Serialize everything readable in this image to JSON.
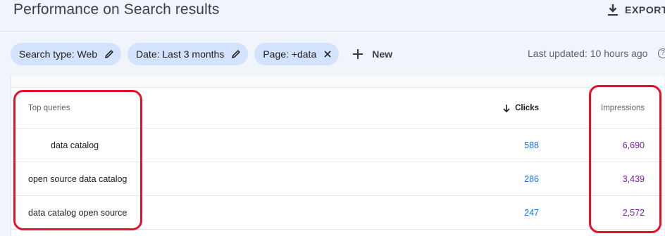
{
  "header": {
    "title": "Performance on Search results",
    "export_label": "EXPORT"
  },
  "filters": {
    "chips": [
      {
        "label": "Search type: Web",
        "action_icon": "pencil-icon"
      },
      {
        "label": "Date: Last 3 months",
        "action_icon": "pencil-icon"
      },
      {
        "label": "Page: +data",
        "action_icon": "close-icon"
      }
    ],
    "new_label": "New",
    "last_updated": "Last updated: 10 hours ago",
    "help_glyph": "?"
  },
  "table": {
    "columns": {
      "query": "Top queries",
      "clicks": "Clicks",
      "impressions": "Impressions"
    },
    "sort": {
      "column": "clicks",
      "direction": "descending"
    },
    "rows": [
      {
        "query": "data catalog",
        "clicks": "588",
        "impressions": "6,690"
      },
      {
        "query": "open source data catalog",
        "clicks": "286",
        "impressions": "3,439"
      },
      {
        "query": "data catalog open source",
        "clicks": "247",
        "impressions": "2,572"
      }
    ]
  },
  "colors": {
    "page_bg": "#f1f4fa",
    "chip_bg": "#d3e3fd",
    "clicks": "#1a73e8",
    "impressions": "#7b1fa2",
    "highlight": "#e8112d"
  }
}
